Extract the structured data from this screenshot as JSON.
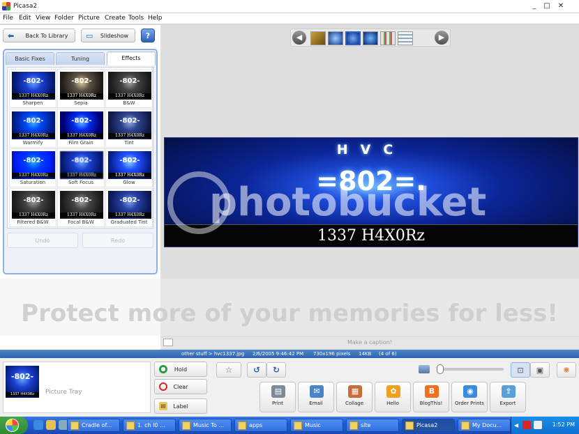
{
  "window": {
    "title": "Picasa2",
    "controls": [
      "_",
      "□",
      "✕"
    ]
  },
  "menu": [
    "File",
    "Edit",
    "View",
    "Folder",
    "Picture",
    "Create",
    "Tools",
    "Help"
  ],
  "toolbar": {
    "back_label": "Back To Library",
    "slideshow_label": "Slideshow",
    "help_label": "?"
  },
  "tabs": [
    {
      "label": "Basic Fixes",
      "active": false
    },
    {
      "label": "Tuning",
      "active": false
    },
    {
      "label": "Effects",
      "active": true
    }
  ],
  "effects": [
    {
      "name": "Sharpen",
      "style": "sharpen"
    },
    {
      "name": "Sepia",
      "style": "sepia"
    },
    {
      "name": "B&W",
      "style": "bw"
    },
    {
      "name": "Warmify",
      "style": "warmify"
    },
    {
      "name": "Film Grain",
      "style": "filmgrain"
    },
    {
      "name": "Tint",
      "style": "tint"
    },
    {
      "name": "Saturation",
      "style": "saturation"
    },
    {
      "name": "Soft Focus",
      "style": "softfocus"
    },
    {
      "name": "Glow",
      "style": "glow"
    },
    {
      "name": "Filtered B&W",
      "style": "filteredbw"
    },
    {
      "name": "Focal B&W",
      "style": "focalbw"
    },
    {
      "name": "Graduated Tint",
      "style": "gradtint"
    }
  ],
  "effect_thumb": {
    "line1": "-802-",
    "line2": "1337 H4X0Rz"
  },
  "undo_label": "Undo",
  "redo_label": "Redo",
  "image": {
    "hvc": "HVC",
    "number": "=802=.",
    "leet": "1337 H4X0Rz"
  },
  "watermark": {
    "brand": "photobucket",
    "slogan": "Protect more of your memories for less!"
  },
  "caption_placeholder": "Make a caption!",
  "info": {
    "path": "other stuff > hvc1337.jpg",
    "date": "2/6/2005 9:46:42 PM",
    "dims": "730x196 pixels",
    "size": "14KB",
    "position": "(4 of 6)"
  },
  "tray": {
    "label": "Picture Tray",
    "hold_label": "Hold",
    "clear_label": "Clear",
    "label_label": "Label"
  },
  "actions": [
    {
      "label": "Print",
      "color": "#7d8a98",
      "icon": "▤"
    },
    {
      "label": "Email",
      "color": "#4c84c8",
      "icon": "✉"
    },
    {
      "label": "Collage",
      "color": "#c86c3c",
      "icon": "▦"
    },
    {
      "label": "Hello",
      "color": "#f0a020",
      "icon": "✿"
    },
    {
      "label": "BlogThis!",
      "color": "#f07020",
      "icon": "B"
    },
    {
      "label": "Order Prints",
      "color": "#3a8ae0",
      "icon": "◉"
    },
    {
      "label": "Export",
      "color": "#5aa0d8",
      "icon": "⇪"
    }
  ],
  "taskbar": {
    "tasks": [
      {
        "label": "Cradle of...",
        "active": false
      },
      {
        "label": "1. ch l0 ...",
        "active": false
      },
      {
        "label": "Music To ...",
        "active": false
      },
      {
        "label": "apps",
        "active": false
      },
      {
        "label": "Music",
        "active": false
      },
      {
        "label": "site",
        "active": false
      },
      {
        "label": "Picasa2",
        "active": true
      },
      {
        "label": "My Docu...",
        "active": false
      }
    ],
    "clock": "1:52 PM"
  }
}
